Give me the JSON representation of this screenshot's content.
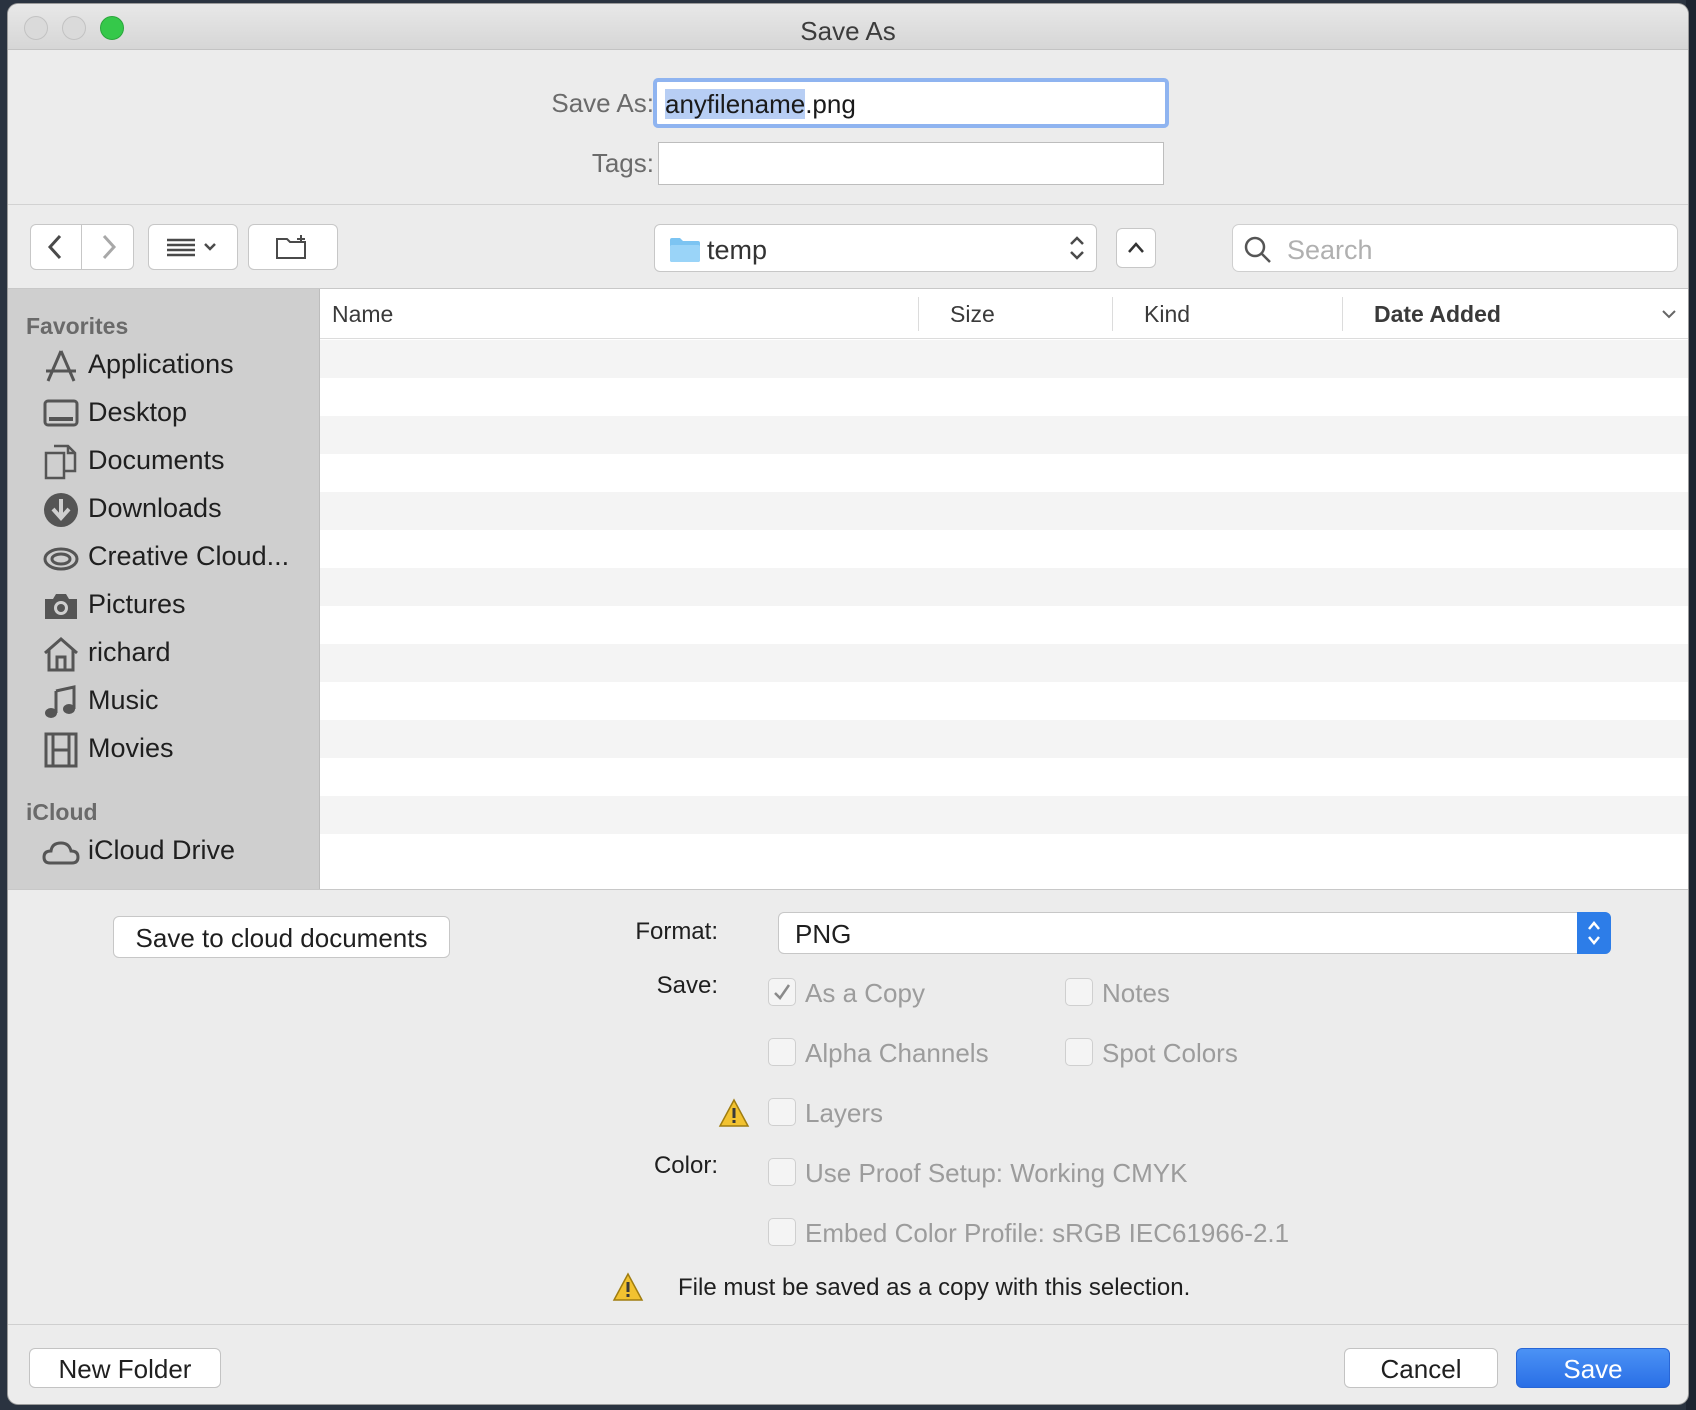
{
  "window": {
    "title": "Save As"
  },
  "form": {
    "save_as_label": "Save As:",
    "filename_selected": "anyfilename",
    "filename_ext": ".png",
    "tags_label": "Tags:",
    "tags_value": ""
  },
  "toolbar": {
    "location": "temp",
    "search_placeholder": "Search"
  },
  "sidebar": {
    "favorites_heading": "Favorites",
    "items": [
      {
        "label": "Applications",
        "icon": "applications-icon"
      },
      {
        "label": "Desktop",
        "icon": "desktop-icon"
      },
      {
        "label": "Documents",
        "icon": "documents-icon"
      },
      {
        "label": "Downloads",
        "icon": "downloads-icon"
      },
      {
        "label": "Creative Cloud...",
        "icon": "creative-cloud-icon"
      },
      {
        "label": "Pictures",
        "icon": "camera-icon"
      },
      {
        "label": "richard",
        "icon": "home-icon"
      },
      {
        "label": "Music",
        "icon": "music-note-icon"
      },
      {
        "label": "Movies",
        "icon": "film-icon"
      }
    ],
    "icloud_heading": "iCloud",
    "icloud_items": [
      {
        "label": "iCloud Drive",
        "icon": "icloud-icon"
      }
    ]
  },
  "file_list": {
    "columns": [
      "Name",
      "Size",
      "Kind",
      "Date Added"
    ],
    "rows": []
  },
  "options": {
    "cloud_button": "Save to cloud documents",
    "format_label": "Format:",
    "format_value": "PNG",
    "save_label": "Save:",
    "color_label": "Color:",
    "checkboxes": {
      "as_a_copy": {
        "label": "As a Copy",
        "checked": true
      },
      "notes": {
        "label": "Notes",
        "checked": false
      },
      "alpha_channels": {
        "label": "Alpha Channels",
        "checked": false
      },
      "spot_colors": {
        "label": "Spot Colors",
        "checked": false
      },
      "layers": {
        "label": "Layers",
        "checked": false
      },
      "use_proof_setup": {
        "label": "Use Proof Setup:  Working CMYK",
        "checked": false
      },
      "embed_color_profile": {
        "label": "Embed Color Profile:  sRGB IEC61966-2.1",
        "checked": false
      }
    },
    "warning_text": "File must be saved as a copy with this selection."
  },
  "buttons": {
    "new_folder": "New Folder",
    "cancel": "Cancel",
    "save": "Save"
  },
  "colors": {
    "accent": "#2d7de8",
    "selection": "#b7cef4",
    "warning": "#f2c230"
  }
}
